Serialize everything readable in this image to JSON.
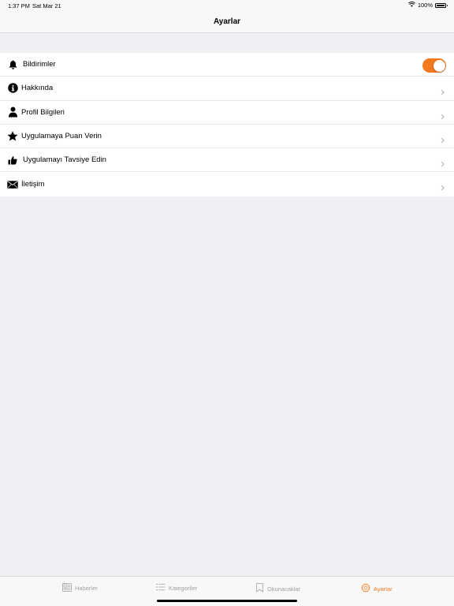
{
  "status": {
    "time": "1:37 PM",
    "date": "Sat Mar 21",
    "battery": "100%"
  },
  "nav": {
    "title": "Ayarlar"
  },
  "settings": {
    "notifications": {
      "label": "Bildirimler",
      "enabled": true
    },
    "about": {
      "label": "Hakkında"
    },
    "profile": {
      "label": "Profil Bilgileri"
    },
    "rate": {
      "label": "Uygulamaya Puan Verin"
    },
    "recommend": {
      "label": "Uygulamayı Tavsiye Edin"
    },
    "contact": {
      "label": "İletişim"
    }
  },
  "tabs": [
    {
      "label": "Haberler",
      "icon": "newspaper-icon"
    },
    {
      "label": "Kategoriler",
      "icon": "list-icon"
    },
    {
      "label": "Okunacaklar",
      "icon": "bookmark-icon"
    },
    {
      "label": "Ayarlar",
      "icon": "gear-icon",
      "active": true
    }
  ],
  "colors": {
    "accent": "#f47a20",
    "background": "#efeff4",
    "tab_inactive": "#a0a0a4"
  }
}
